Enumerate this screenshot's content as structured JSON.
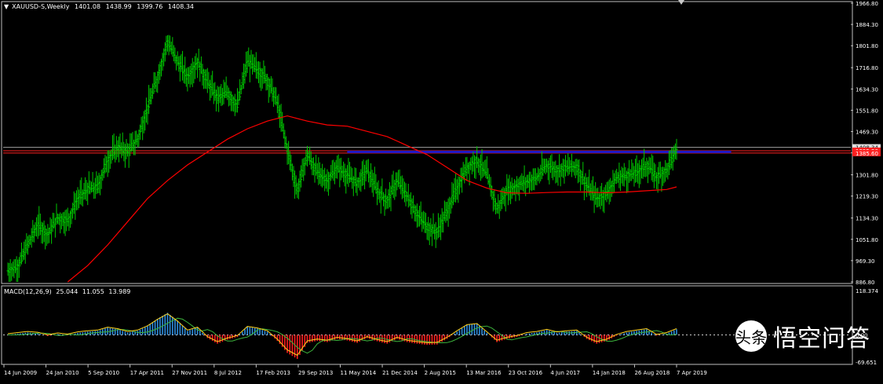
{
  "header": {
    "symbol": "XAUUSD-S,Weekly",
    "open": "1401.08",
    "high": "1438.99",
    "low": "1399.76",
    "close": "1408.34"
  },
  "macd_header": {
    "label": "MACD(12,26,9)",
    "v1": "25.044",
    "v2": "11.055",
    "v3": "13.989"
  },
  "watermark": {
    "logo": "头条",
    "text": "悟空问答"
  },
  "colors": {
    "background": "#000000",
    "candles": "#00c800",
    "ma": "#ff0000",
    "zone": "#1e18c8",
    "hist_pos": "#2f8fe0",
    "hist_neg": "#ff1e1e",
    "macd_line": "#ffd21e",
    "signal_line": "#3cb43c"
  },
  "chart_data": [
    {
      "type": "line",
      "title": "",
      "symbol": "XAUUSD-S",
      "timeframe": "Weekly",
      "ylim": [
        886.8,
        1966.8
      ],
      "price_scale_labels": [
        "1966.80",
        "1884.30",
        "1801.80",
        "1716.80",
        "1634.30",
        "1551.80",
        "1469.30",
        "1386.80",
        "1301.80",
        "1219.30",
        "1134.30",
        "1051.80",
        "969.30",
        "886.80"
      ],
      "price_markers": [
        "1408.34",
        "1395.20",
        "1385.60"
      ],
      "x_tick_labels": [
        "14 Jun 2009",
        "24 Jan 2010",
        "5 Sep 2010",
        "17 Apr 2011",
        "27 Nov 2011",
        "8 Jul 2012",
        "17 Feb 2013",
        "29 Sep 2013",
        "11 May 2014",
        "21 Dec 2014",
        "2 Aug 2015",
        "13 Mar 2016",
        "23 Oct 2016",
        "4 Jun 2017",
        "14 Jan 2018",
        "26 Aug 2018",
        "7 Apr 2019"
      ],
      "series": [
        {
          "kind": "close",
          "values": [
            [
              0,
              930
            ],
            [
              1,
              945
            ],
            [
              2,
              1030
            ],
            [
              3,
              1110
            ],
            [
              4,
              1070
            ],
            [
              5,
              1135
            ],
            [
              6,
              1125
            ],
            [
              7,
              1210
            ],
            [
              8,
              1245
            ],
            [
              9,
              1255
            ],
            [
              10,
              1360
            ],
            [
              11,
              1410
            ],
            [
              12,
              1390
            ],
            [
              13,
              1440
            ],
            [
              14,
              1560
            ],
            [
              15,
              1680
            ],
            [
              16,
              1820
            ],
            [
              17,
              1740
            ],
            [
              18,
              1680
            ],
            [
              19,
              1740
            ],
            [
              20,
              1660
            ],
            [
              21,
              1600
            ],
            [
              22,
              1620
            ],
            [
              23,
              1570
            ],
            [
              24,
              1740
            ],
            [
              25,
              1710
            ],
            [
              26,
              1670
            ],
            [
              27,
              1580
            ],
            [
              28,
              1400
            ],
            [
              29,
              1240
            ],
            [
              30,
              1380
            ],
            [
              31,
              1310
            ],
            [
              32,
              1280
            ],
            [
              33,
              1330
            ],
            [
              34,
              1300
            ],
            [
              35,
              1270
            ],
            [
              36,
              1320
            ],
            [
              37,
              1240
            ],
            [
              38,
              1200
            ],
            [
              39,
              1280
            ],
            [
              40,
              1220
            ],
            [
              41,
              1150
            ],
            [
              42,
              1100
            ],
            [
              43,
              1080
            ],
            [
              44,
              1160
            ],
            [
              45,
              1250
            ],
            [
              46,
              1330
            ],
            [
              47,
              1360
            ],
            [
              48,
              1300
            ],
            [
              49,
              1170
            ],
            [
              50,
              1240
            ],
            [
              51,
              1260
            ],
            [
              52,
              1275
            ],
            [
              53,
              1290
            ],
            [
              54,
              1340
            ],
            [
              55,
              1320
            ],
            [
              56,
              1330
            ],
            [
              57,
              1335
            ],
            [
              58,
              1260
            ],
            [
              59,
              1210
            ],
            [
              60,
              1230
            ],
            [
              61,
              1290
            ],
            [
              62,
              1300
            ],
            [
              63,
              1310
            ],
            [
              64,
              1340
            ],
            [
              65,
              1295
            ],
            [
              66,
              1320
            ],
            [
              67,
              1400
            ]
          ]
        },
        {
          "kind": "moving_average",
          "values": [
            [
              6,
              886.8
            ],
            [
              8,
              950
            ],
            [
              10,
              1030
            ],
            [
              12,
              1120
            ],
            [
              14,
              1210
            ],
            [
              16,
              1280
            ],
            [
              18,
              1340
            ],
            [
              20,
              1390
            ],
            [
              22,
              1440
            ],
            [
              24,
              1480
            ],
            [
              26,
              1510
            ],
            [
              28,
              1530
            ],
            [
              30,
              1510
            ],
            [
              32,
              1495
            ],
            [
              34,
              1490
            ],
            [
              36,
              1470
            ],
            [
              38,
              1450
            ],
            [
              40,
              1415
            ],
            [
              42,
              1380
            ],
            [
              44,
              1330
            ],
            [
              46,
              1280
            ],
            [
              48,
              1250
            ],
            [
              50,
              1232
            ],
            [
              52,
              1230
            ],
            [
              54,
              1233
            ],
            [
              56,
              1235
            ],
            [
              58,
              1235
            ],
            [
              60,
              1232
            ],
            [
              62,
              1235
            ],
            [
              64,
              1240
            ],
            [
              66,
              1245
            ],
            [
              67,
              1255
            ]
          ]
        }
      ],
      "zone": {
        "from": 1386,
        "to": 1395
      }
    },
    {
      "type": "bar",
      "title": "MACD(12,26,9)",
      "ylim": [
        -69.651,
        118.374
      ],
      "scale_labels": [
        "118.374",
        "0.00",
        "-69.651"
      ],
      "series": [
        {
          "name": "histogram",
          "values": [
            0,
            3,
            6,
            4,
            -3,
            2,
            -1,
            5,
            8,
            10,
            18,
            14,
            6,
            10,
            22,
            40,
            55,
            35,
            10,
            18,
            -8,
            -22,
            -12,
            -5,
            20,
            16,
            8,
            -15,
            -45,
            -60,
            -20,
            -15,
            -18,
            -10,
            -14,
            -20,
            -8,
            -16,
            -22,
            -10,
            -18,
            -22,
            -25,
            -24,
            -10,
            8,
            25,
            28,
            5,
            -18,
            -10,
            -5,
            3,
            6,
            12,
            5,
            8,
            10,
            -10,
            -22,
            -15,
            -2,
            6,
            10,
            14,
            -2,
            3,
            14
          ]
        }
      ]
    }
  ]
}
